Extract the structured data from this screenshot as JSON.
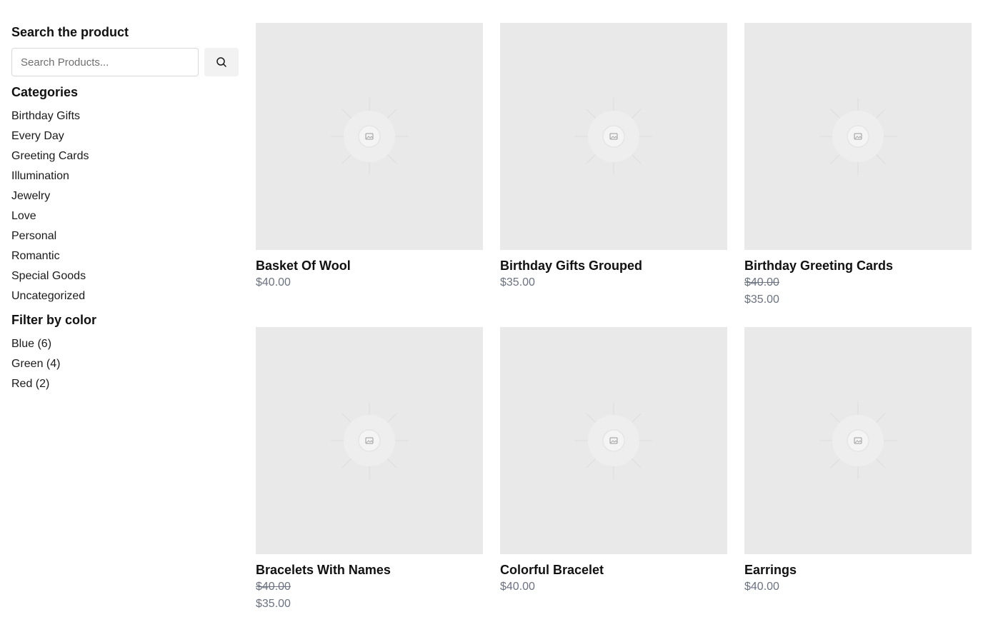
{
  "sidebar": {
    "search_heading": "Search the product",
    "search_placeholder": "Search Products...",
    "categories_heading": "Categories",
    "categories": [
      "Birthday Gifts",
      "Every Day",
      "Greeting Cards",
      "Illumination",
      "Jewelry",
      "Love",
      "Personal",
      "Romantic",
      "Special Goods",
      "Uncategorized"
    ],
    "color_heading": "Filter by color",
    "colors": [
      "Blue (6)",
      "Green (4)",
      "Red (2)"
    ]
  },
  "products": [
    {
      "title": "Basket Of Wool",
      "price": "$40.00",
      "old_price": ""
    },
    {
      "title": "Birthday Gifts Grouped",
      "price": "$35.00",
      "old_price": ""
    },
    {
      "title": "Birthday Greeting Cards",
      "price": "$35.00",
      "old_price": "$40.00"
    },
    {
      "title": "Bracelets With Names",
      "price": "$35.00",
      "old_price": "$40.00"
    },
    {
      "title": "Colorful Bracelet",
      "price": "$40.00",
      "old_price": ""
    },
    {
      "title": "Earrings",
      "price": "$40.00",
      "old_price": ""
    }
  ],
  "icons": {
    "search": "search-icon",
    "placeholder": "image-placeholder-icon"
  },
  "colors": {
    "thumb_bg": "#e9e9e9",
    "price": "#6b7280",
    "search_btn_bg": "#f2f2f2"
  }
}
